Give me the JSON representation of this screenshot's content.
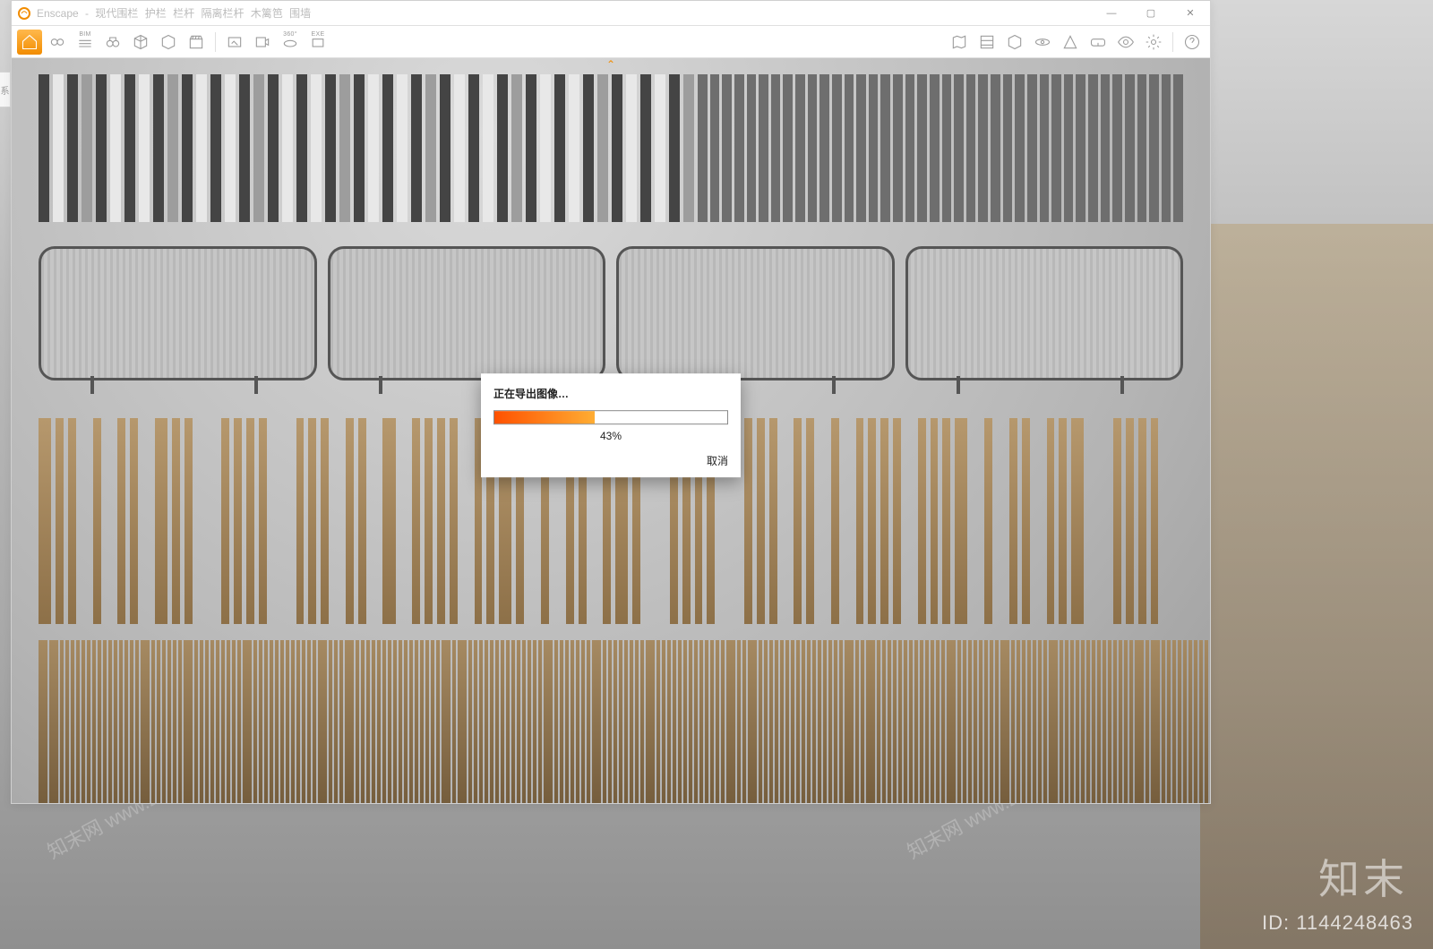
{
  "app": {
    "name": "Enscape",
    "title_parts": [
      "现代围栏",
      "护栏",
      "栏杆",
      "隔离栏杆",
      "木篱笆",
      "围墙"
    ]
  },
  "window_controls": {
    "min": "—",
    "max": "▢",
    "close": "✕"
  },
  "toolbar": {
    "left": [
      {
        "name": "home-icon",
        "label": "",
        "active": true
      },
      {
        "name": "link-icon",
        "label": "",
        "active": false
      },
      {
        "name": "bim-icon",
        "label": "BIM",
        "active": false
      },
      {
        "name": "binoculars-icon",
        "label": "",
        "active": false
      },
      {
        "name": "cube-a-icon",
        "label": "",
        "active": false
      },
      {
        "name": "cube-icon",
        "label": "",
        "active": false
      },
      {
        "name": "clapper-icon",
        "label": "",
        "active": false
      }
    ],
    "mid": [
      {
        "name": "export-image-icon",
        "label": ""
      },
      {
        "name": "export-video-icon",
        "label": ""
      },
      {
        "name": "export-360-icon",
        "label": "360°"
      },
      {
        "name": "export-exe-icon",
        "label": "EXE"
      }
    ],
    "right": [
      {
        "name": "map-icon"
      },
      {
        "name": "assets-icon"
      },
      {
        "name": "object-icon"
      },
      {
        "name": "orbit-icon"
      },
      {
        "name": "fov-icon"
      },
      {
        "name": "vr-icon"
      },
      {
        "name": "eye-icon"
      },
      {
        "name": "gear-icon"
      },
      {
        "name": "help-icon"
      }
    ]
  },
  "viewport": {
    "top_chevron": "⌃"
  },
  "modal": {
    "title": "正在导出图像…",
    "progress_pct": 43,
    "pct_text": "43%",
    "cancel": "取消"
  },
  "watermark": {
    "diag": "知末网 www.znzmo.com",
    "brand_cn": "知末",
    "id_label": "ID: 1144248463"
  },
  "left_edge_label": "系"
}
